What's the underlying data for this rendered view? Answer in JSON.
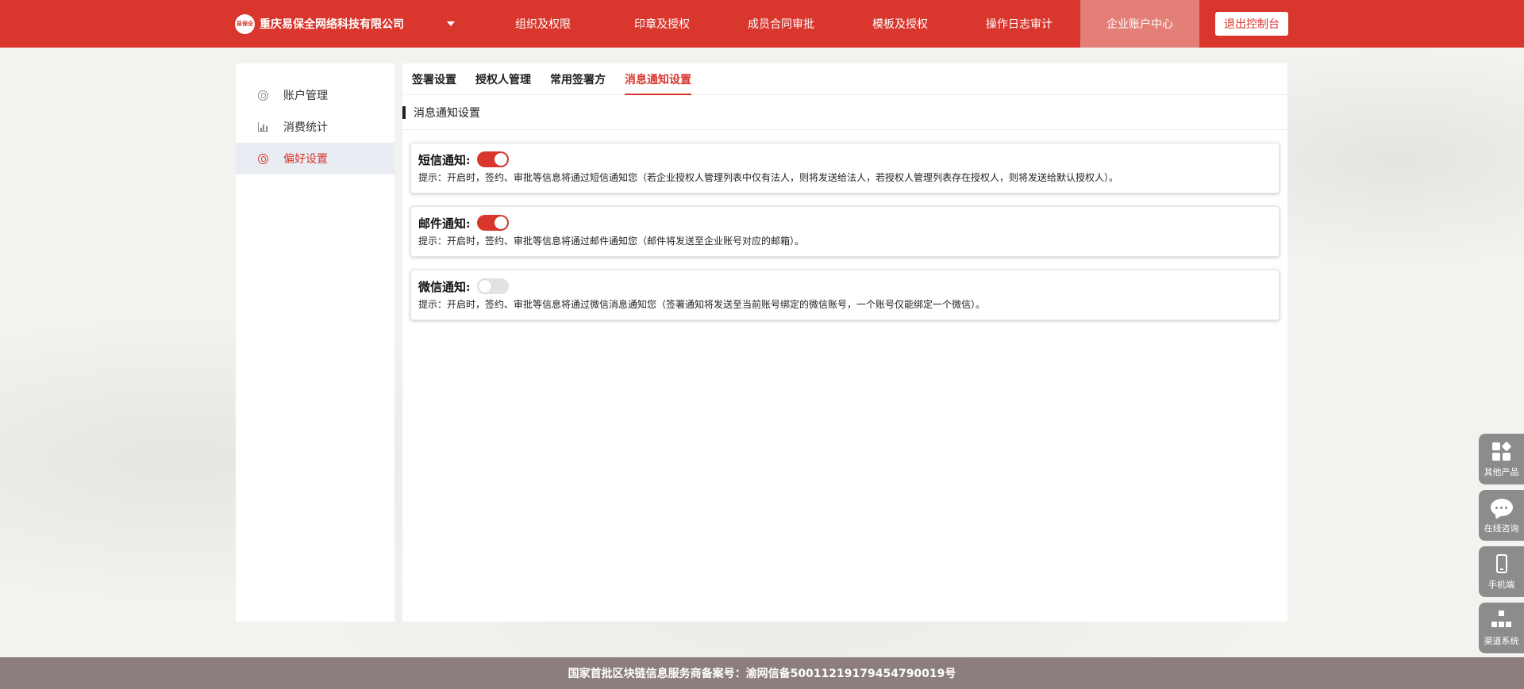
{
  "header": {
    "company_name": "重庆易保全网络科技有限公司",
    "logo_text": "易保全",
    "nav": [
      {
        "label": "组织及权限"
      },
      {
        "label": "印章及授权"
      },
      {
        "label": "成员合同审批"
      },
      {
        "label": "模板及授权"
      },
      {
        "label": "操作日志审计"
      },
      {
        "label": "企业账户中心",
        "active": true
      }
    ],
    "exit_label": "退出控制台",
    "accent_color": "#d9362d"
  },
  "sidebar": {
    "items": [
      {
        "label": "账户管理",
        "icon": "user-circle-icon"
      },
      {
        "label": "消费统计",
        "icon": "bar-chart-icon"
      },
      {
        "label": "偏好设置",
        "icon": "user-circle-icon",
        "active": true
      }
    ]
  },
  "main": {
    "tabs": [
      {
        "label": "签署设置"
      },
      {
        "label": "授权人管理"
      },
      {
        "label": "常用签署方"
      },
      {
        "label": "消息通知设置",
        "active": true
      }
    ],
    "section_title": "消息通知设置",
    "notifications": [
      {
        "title": "短信通知:",
        "enabled": true,
        "hint": "提示：开启时，签约、审批等信息将通过短信通知您（若企业授权人管理列表中仅有法人，则将发送给法人，若授权人管理列表存在授权人，则将发送给默认授权人）。"
      },
      {
        "title": "邮件通知:",
        "enabled": true,
        "hint": "提示：开启时，签约、审批等信息将通过邮件通知您（邮件将发送至企业账号对应的邮箱）。"
      },
      {
        "title": "微信通知:",
        "enabled": false,
        "hint": "提示：开启时，签约、审批等信息将通过微信消息通知您（签署通知将发送至当前账号绑定的微信账号，一个账号仅能绑定一个微信）。"
      }
    ]
  },
  "float_tools": [
    {
      "label": "其他产品",
      "icon": "apps-icon"
    },
    {
      "label": "在线咨询",
      "icon": "chat-bubble-icon"
    },
    {
      "label": "手机端",
      "icon": "mobile-phone-icon"
    },
    {
      "label": "渠道系统",
      "icon": "org-tree-icon"
    }
  ],
  "footer": {
    "text": "国家首批区块链信息服务商备案号：渝网信备50011219179454790019号"
  }
}
